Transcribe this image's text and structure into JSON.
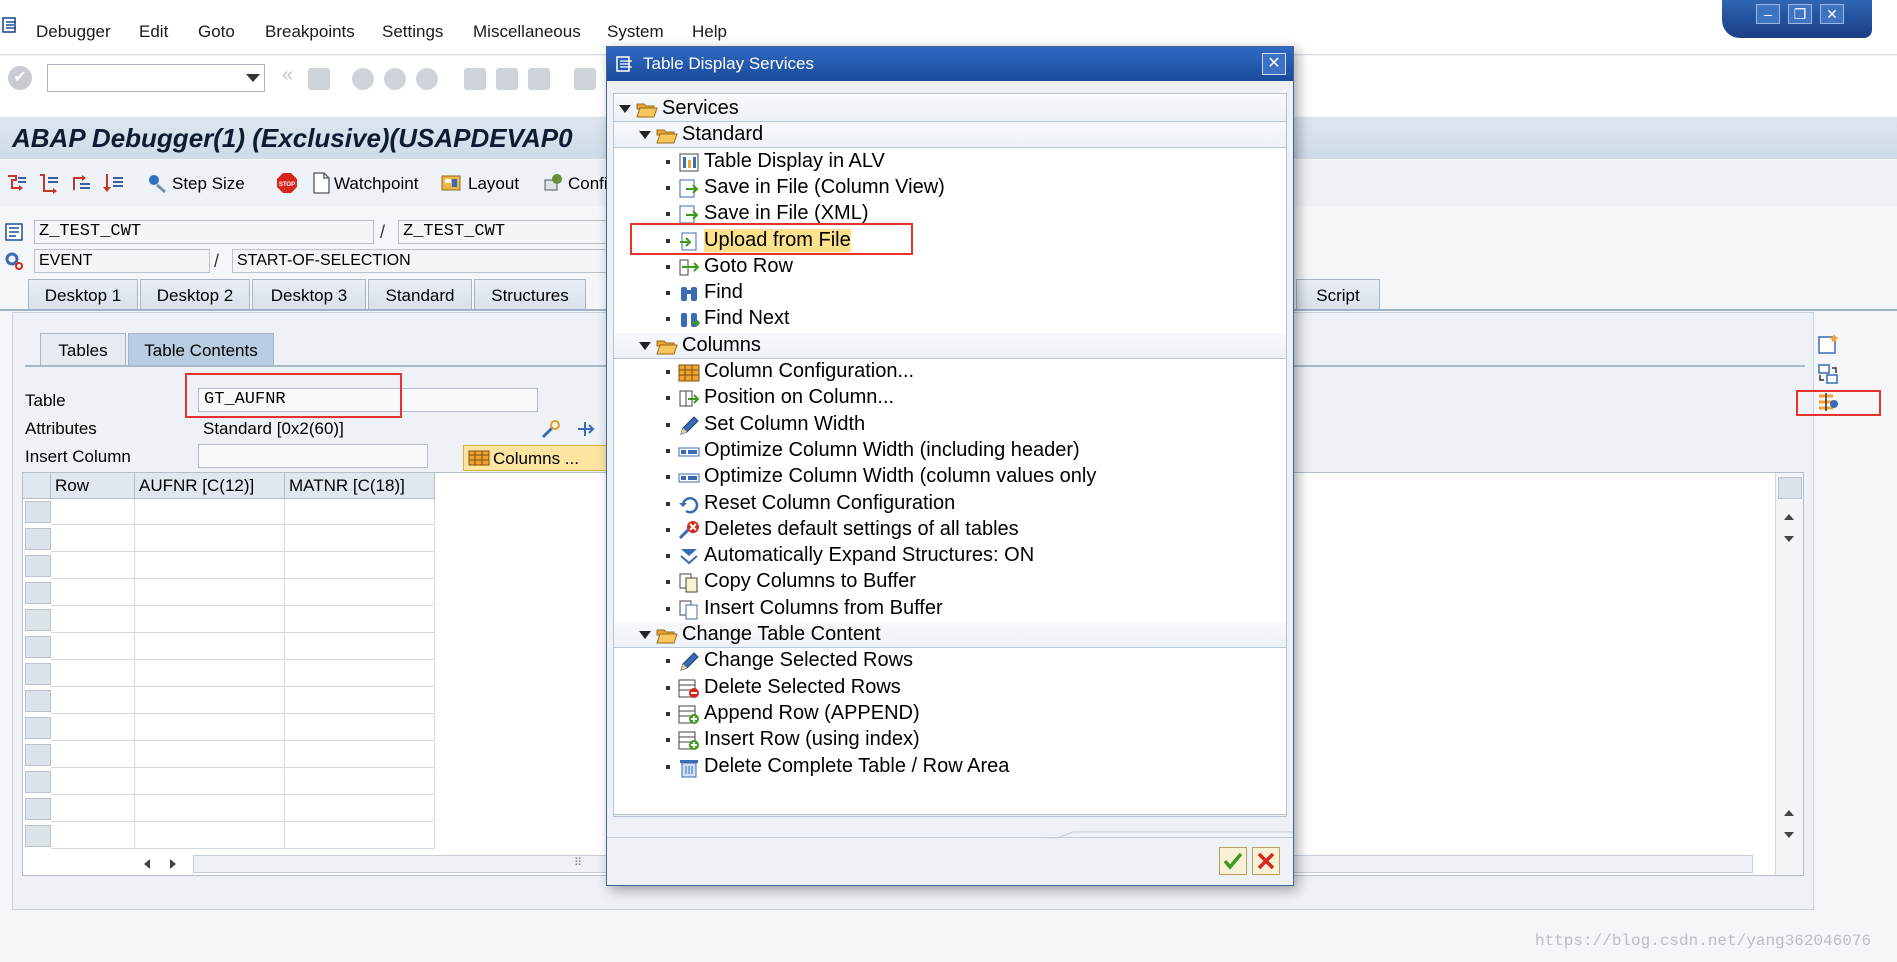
{
  "menu": {
    "items": [
      "Debugger",
      "Edit",
      "Goto",
      "Breakpoints",
      "Settings",
      "Miscellaneous",
      "System",
      "Help"
    ]
  },
  "window_controls": {
    "minimize": "–",
    "restore": "❐",
    "close": "✕"
  },
  "command_field": {
    "value": ""
  },
  "title": "ABAP Debugger(1)  (Exclusive)(USAPDEVAP0",
  "app_toolbar": {
    "step_size": "Step Size",
    "watchpoint": "Watchpoint",
    "layout": "Layout",
    "config": "Confi"
  },
  "program": {
    "main": "Z_TEST_CWT",
    "include": "Z_TEST_CWT",
    "event_type": "EVENT",
    "event_name": "START-OF-SELECTION",
    "separator": "/"
  },
  "desktop_tabs": [
    "Desktop 1",
    "Desktop 2",
    "Desktop 3",
    "Standard",
    "Structures",
    "Script"
  ],
  "sub_tabs": [
    "Tables",
    "Table Contents"
  ],
  "table_tool": {
    "table_label": "Table",
    "table_value": "GT_AUFNR",
    "attributes_label": "Attributes",
    "attributes_value": "Standard [0x2(60)]",
    "insert_column_label": "Insert Column",
    "insert_column_value": "",
    "columns_button": "Columns ..."
  },
  "grid": {
    "columns": [
      "Row",
      "AUFNR [C(12)]",
      "MATNR [C(18)]"
    ],
    "scroll_grip": "⠿"
  },
  "dialog": {
    "title": "Table Display Services",
    "close": "✕",
    "tree": [
      {
        "level": 0,
        "type": "folder",
        "label": "Services"
      },
      {
        "level": 1,
        "type": "folder",
        "label": "Standard"
      },
      {
        "level": 2,
        "type": "item",
        "label": "Table Display in ALV",
        "icon": "alv-icon"
      },
      {
        "level": 2,
        "type": "item",
        "label": "Save in File (Column View)",
        "icon": "save-file-icon"
      },
      {
        "level": 2,
        "type": "item",
        "label": "Save in File (XML)",
        "icon": "save-xml-icon"
      },
      {
        "level": 2,
        "type": "item",
        "label": "Upload from File",
        "icon": "upload-icon",
        "highlighted": true
      },
      {
        "level": 2,
        "type": "item",
        "label": "Goto Row",
        "icon": "goto-row-icon"
      },
      {
        "level": 2,
        "type": "item",
        "label": "Find",
        "icon": "binoculars-icon"
      },
      {
        "level": 2,
        "type": "item",
        "label": "Find Next",
        "icon": "find-next-icon"
      },
      {
        "level": 1,
        "type": "folder",
        "label": "Columns"
      },
      {
        "level": 2,
        "type": "item",
        "label": "Column Configuration...",
        "icon": "column-config-icon"
      },
      {
        "level": 2,
        "type": "item",
        "label": "Position on Column...",
        "icon": "position-column-icon"
      },
      {
        "level": 2,
        "type": "item",
        "label": "Set Column Width",
        "icon": "pencil-icon"
      },
      {
        "level": 2,
        "type": "item",
        "label": "Optimize Column Width (including header)",
        "icon": "optimize-width-icon"
      },
      {
        "level": 2,
        "type": "item",
        "label": "Optimize Column Width (column values only",
        "icon": "optimize-values-icon"
      },
      {
        "level": 2,
        "type": "item",
        "label": "Reset Column Configuration",
        "icon": "reset-icon"
      },
      {
        "level": 2,
        "type": "item",
        "label": "Deletes default settings of all tables",
        "icon": "delete-settings-icon"
      },
      {
        "level": 2,
        "type": "item",
        "label": "Automatically Expand Structures: ON",
        "icon": "expand-structures-icon"
      },
      {
        "level": 2,
        "type": "item",
        "label": "Copy Columns to Buffer",
        "icon": "copy-icon"
      },
      {
        "level": 2,
        "type": "item",
        "label": "Insert Columns from Buffer",
        "icon": "insert-buffer-icon"
      },
      {
        "level": 1,
        "type": "folder",
        "label": "Change Table Content"
      },
      {
        "level": 2,
        "type": "item",
        "label": "Change Selected Rows",
        "icon": "pencil-icon"
      },
      {
        "level": 2,
        "type": "item",
        "label": "Delete Selected Rows",
        "icon": "delete-rows-icon"
      },
      {
        "level": 2,
        "type": "item",
        "label": "Append Row (APPEND)",
        "icon": "append-row-icon"
      },
      {
        "level": 2,
        "type": "item",
        "label": "Insert Row (using index)",
        "icon": "insert-row-icon"
      },
      {
        "level": 2,
        "type": "item",
        "label": "Delete Complete Table / Row Area",
        "icon": "trash-icon"
      }
    ]
  },
  "watermark": "https://blog.csdn.net/yang362046076",
  "colors": {
    "accent_blue": "#1b4a9a",
    "highlight": "#fbe18a",
    "annotation_red": "#e8322e"
  }
}
